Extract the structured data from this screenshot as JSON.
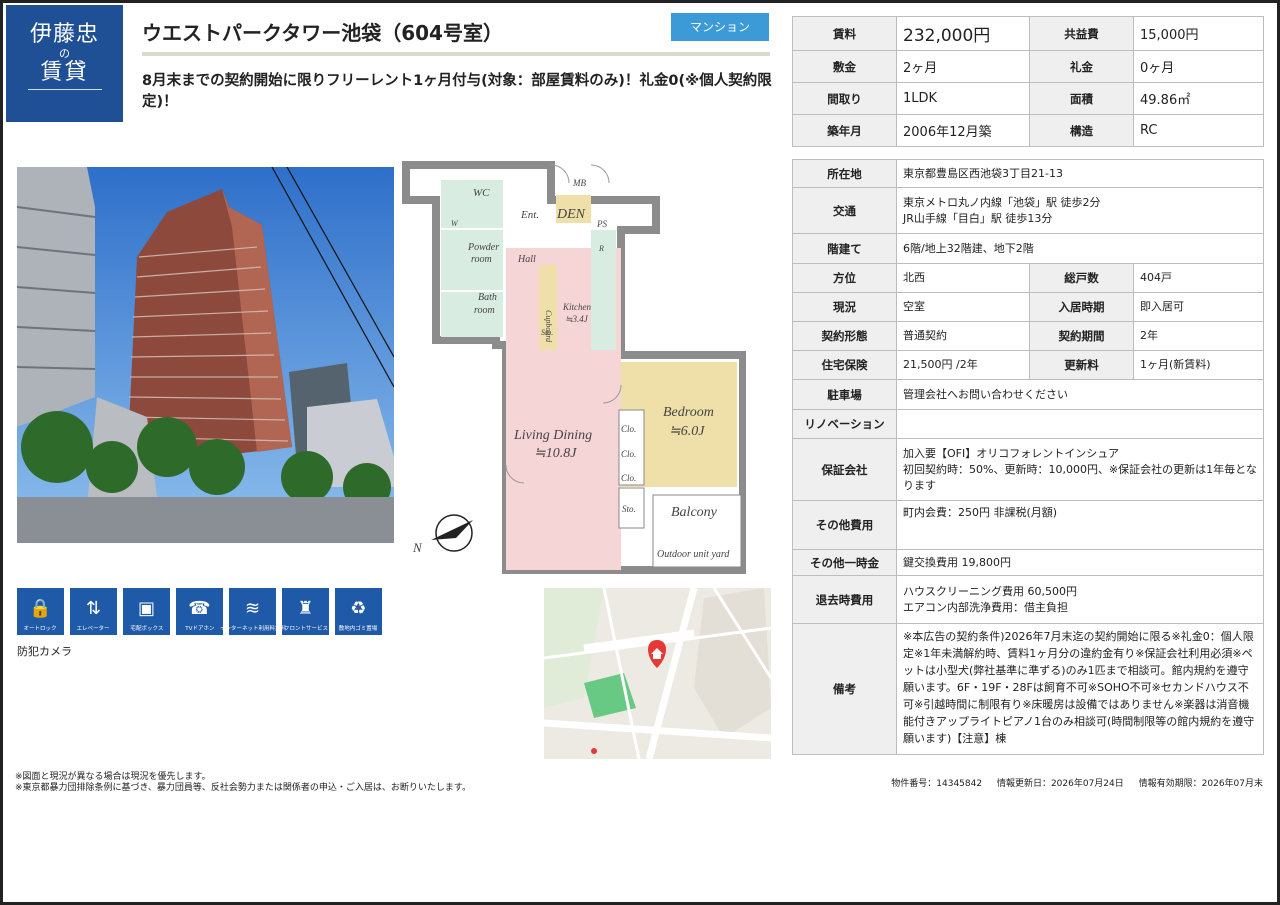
{
  "logo": {
    "line1": "伊藤忠",
    "line2": "の",
    "line3": "賃貸"
  },
  "property": {
    "title": "ウエストパークタワー池袋（604号室）",
    "type_badge": "マンション",
    "catchcopy": "8月末までの契約開始に限りフリーレント1ヶ月付与(対象：部屋賃料のみ)！礼金0(※個人契約限定)！"
  },
  "summary": {
    "rent_label": "賃料",
    "rent": "232,000円",
    "fee_label": "共益費",
    "fee": "15,000円",
    "deposit_label": "敷金",
    "deposit": "2ヶ月",
    "key_money_label": "礼金",
    "key_money": "0ヶ月",
    "layout_label": "間取り",
    "layout": "1LDK",
    "area_label": "面積",
    "area": "49.86㎡",
    "built_label": "築年月",
    "built": "2006年12月築",
    "structure_label": "構造",
    "structure": "RC"
  },
  "details": {
    "address_label": "所在地",
    "address": "東京都豊島区西池袋3丁目21-13",
    "transit_label": "交通",
    "transit_1": "東京メトロ丸ノ内線「池袋」駅 徒歩2分",
    "transit_2": "JR山手線「目白」駅 徒歩13分",
    "floor_label": "階建て",
    "floor": "6階/地上32階建、地下2階",
    "direction_label": "方位",
    "direction": "北西",
    "units_label": "総戸数",
    "units": "404戸",
    "status_label": "現況",
    "status": "空室",
    "move_in_label": "入居時期",
    "move_in": "即入居可",
    "contract_type_label": "契約形態",
    "contract_type": "普通契約",
    "contract_period_label": "契約期間",
    "contract_period": "2年",
    "insurance_label": "住宅保険",
    "insurance": "21,500円 /2年",
    "renewal_label": "更新料",
    "renewal": "1ヶ月(新賃料)",
    "parking_label": "駐車場",
    "parking": "管理会社へお問い合わせください",
    "renovation_label": "リノベーション",
    "renovation": "",
    "guarantor_label": "保証会社",
    "guarantor_1": "加入要【OFI】オリコフォレントインシュア",
    "guarantor_2": "初回契約時：50%、更新時：10,000円、※保証会社の更新は1年毎となります",
    "other_fees_label": "その他費用",
    "other_fees": "町内会費：250円 非課税(月額)",
    "other_once_label": "その他一時金",
    "other_once": "鍵交換費用 19,800円",
    "move_out_label": "退去時費用",
    "move_out_1": "ハウスクリーニング費用 60,500円",
    "move_out_2": "エアコン内部洗浄費用：借主負担",
    "remarks_label": "備考",
    "remarks": "※本広告の契約条件)2026年7月末迄の契約開始に限る※礼金0：個人限定※1年未満解約時、賃料1ヶ月分の違約金有り※保証会社利用必須※ペットは小型犬(弊社基準に準ずる)のみ1匹まで相談可。館内規約を遵守願います。6F・19F・28Fは飼育不可※SOHO不可※セカンドハウス不可※引越時間に制限有り※床暖房は設備ではありません※楽器は消音機能付きアップライトピアノ1台のみ相談可(時間制限等の館内規約を遵守願います)【注意】棟"
  },
  "floorplan": {
    "wc": "WC",
    "mb": "MB",
    "ent": "Ent.",
    "den": "DEN",
    "ps": "PS",
    "w": "W",
    "r": "R",
    "powder": "Powder",
    "room": "room",
    "hall": "Hall",
    "cupboard": "Cupboard",
    "kitchen": "Kitchen",
    "kitchen_size": "≒3.4J",
    "bath": "Bath",
    "sto": "Sto.",
    "clo": "Clo.",
    "living": "Living Dining",
    "living_size": "≒10.8J",
    "bedroom": "Bedroom",
    "bedroom_size": "≒6.0J",
    "balcony": "Balcony",
    "outdoor": "Outdoor unit yard",
    "north": "N"
  },
  "features": [
    {
      "icon": "auto-lock-icon",
      "glyph": "🔒",
      "label": "オートロック"
    },
    {
      "icon": "elevator-icon",
      "glyph": "⇅",
      "label": "エレベーター"
    },
    {
      "icon": "delivery-box-icon",
      "glyph": "▣",
      "label": "宅配ボックス"
    },
    {
      "icon": "tv-intercom-icon",
      "glyph": "☎",
      "label": "TVドアホン"
    },
    {
      "icon": "internet-icon",
      "glyph": "≋",
      "label": "インターネット利用料無料"
    },
    {
      "icon": "front-service-icon",
      "glyph": "♜",
      "label": "フロントサービス"
    },
    {
      "icon": "garbage-icon",
      "glyph": "♻",
      "label": "敷地内ゴミ置場"
    }
  ],
  "extra_feature": "防犯カメラ",
  "notes": [
    "※図面と現況が異なる場合は現況を優先します。",
    "※東京都暴力団排除条例に基づき、暴力団員等、反社会勢力または関係者の申込・ご入居は、お断りいたします。"
  ],
  "footer": {
    "property_no": "物件番号：14345842",
    "updated": "情報更新日：2026年07月24日",
    "valid_until": "情報有効期限：2026年07月末"
  },
  "colors": {
    "brand": "#1f4f95",
    "badge": "#3c9bd6",
    "pin": "#e53935"
  }
}
